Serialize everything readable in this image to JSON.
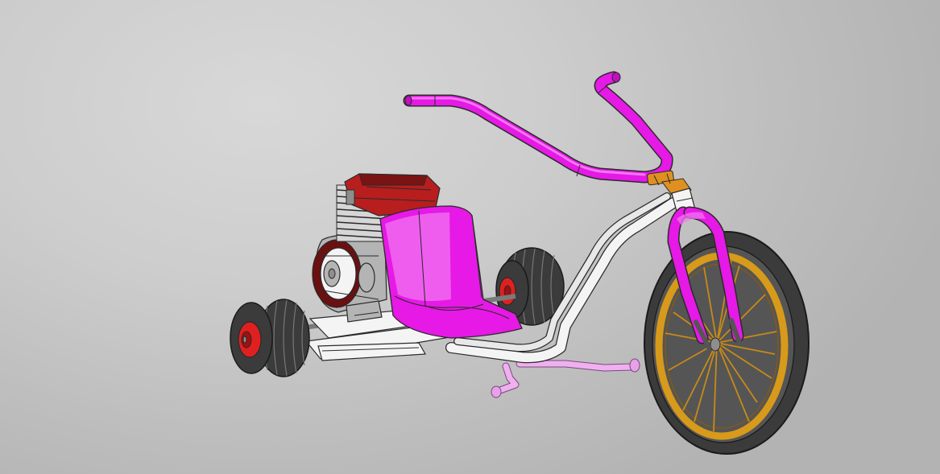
{
  "scene": {
    "background_color": "#c8c8c8",
    "subject": "drift-trike-cad-model",
    "palette": {
      "frame_magenta": "#e619e6",
      "frame_highlight": "#f27af2",
      "peg_pink": "#f0b0f0",
      "frame_white": "#f4f4f4",
      "outline": "#2a2a2a",
      "engine_red": "#b81e1e",
      "engine_dark_red": "#6a1010",
      "hub_red": "#e02020",
      "tire_black": "#3b3b3b",
      "rim_gold": "#d89a1a",
      "stem_orange": "#e09020",
      "engine_grey": "#a8a8a8",
      "steel": "#8e8e8e"
    }
  }
}
